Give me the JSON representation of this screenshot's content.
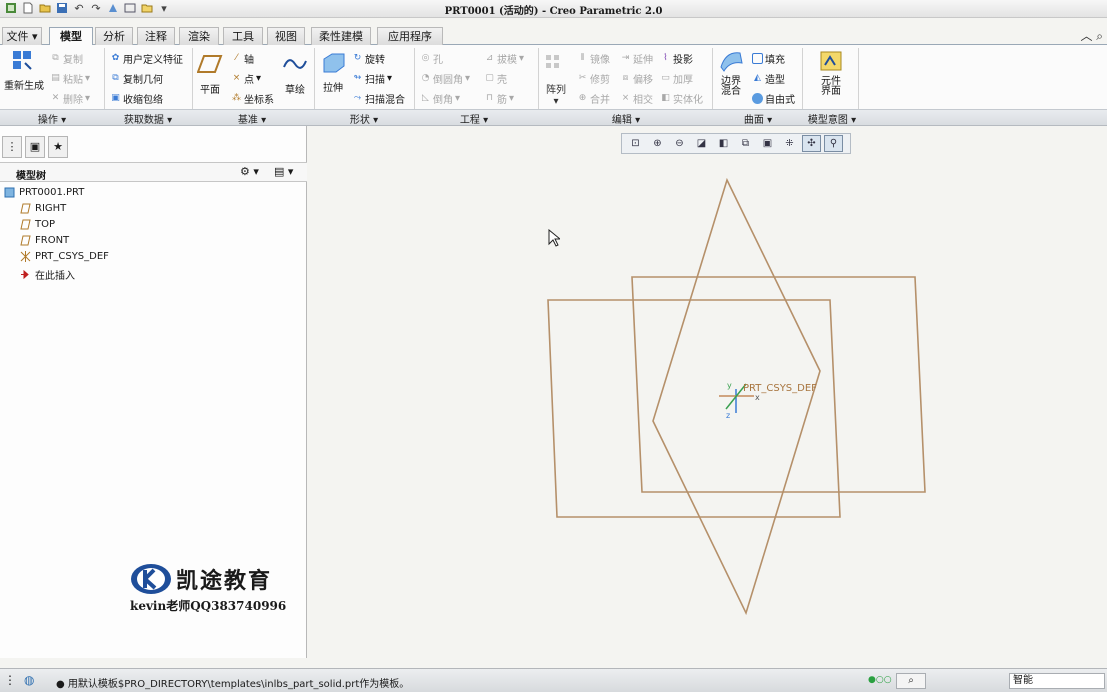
{
  "window": {
    "title": "PRT0001 (活动的) - Creo Parametric 2.0"
  },
  "quick_access": {
    "icons": [
      "app-icon",
      "new-icon",
      "open-icon",
      "save-icon",
      "undo-icon",
      "redo-icon",
      "regenerate-icon",
      "window-icon",
      "close-icon",
      "customize-icon"
    ]
  },
  "tabs": [
    "文件",
    "模型",
    "分析",
    "注释",
    "渲染",
    "工具",
    "视图",
    "柔性建模",
    "应用程序"
  ],
  "ribbon": {
    "operations": {
      "regenerate": "重新生成",
      "copy": "复制",
      "paste": "粘贴",
      "delete": "删除"
    },
    "get_data": {
      "udf": "用户定义特征",
      "copy_geom": "复制几何",
      "shrinkwrap": "收缩包络"
    },
    "datum": {
      "plane": "平面",
      "axis": "轴",
      "point": "点",
      "csys": "坐标系",
      "sketch": "草绘"
    },
    "shapes": {
      "extrude": "拉伸",
      "revolve": "旋转",
      "sweep": "扫描",
      "swept_blend": "扫描混合"
    },
    "engineering": {
      "hole": "孔",
      "round": "倒圆角",
      "chamfer": "倒角",
      "draft": "拔模",
      "shell": "壳",
      "rib": "筋"
    },
    "editing": {
      "pattern": "阵列",
      "mirror": "镜像",
      "trim": "修剪",
      "merge": "合并",
      "extend": "延伸",
      "offset": "偏移",
      "intersect": "相交",
      "project": "投影",
      "thicken": "加厚",
      "solidify": "实体化"
    },
    "surfaces": {
      "boundary_blend": "边界混合",
      "fill": "填充",
      "style": "造型",
      "freestyle": "自由式"
    },
    "model_intent": {
      "component_interface": "元件界面"
    }
  },
  "groups": [
    "操作",
    "获取数据",
    "基准",
    "形状",
    "工程",
    "编辑",
    "曲面",
    "模型意图"
  ],
  "model_tree": {
    "header": "模型树",
    "items": [
      {
        "label": "PRT0001.PRT",
        "icon": "part-icon"
      },
      {
        "label": "RIGHT",
        "icon": "datum-plane-icon"
      },
      {
        "label": "TOP",
        "icon": "datum-plane-icon"
      },
      {
        "label": "FRONT",
        "icon": "datum-plane-icon"
      },
      {
        "label": "PRT_CSYS_DEF",
        "icon": "csys-icon"
      },
      {
        "label": "在此插入",
        "icon": "insert-here-arrow-icon"
      }
    ]
  },
  "watermark": {
    "brand": "凯途教育",
    "contact": "kevin老师QQ383740996"
  },
  "graphics": {
    "csys_label": "PRT_CSYS_DEF",
    "plane_color": "#b5906a"
  },
  "status": {
    "message": "用默认模板$PRO_DIRECTORY\\templates\\inlbs_part_solid.prt作为模板。",
    "filter": "智能"
  },
  "colors": {
    "ribbon_bg": "#fbfbfb",
    "canvas_bg": "#f4f4f1",
    "accent": "#1f4e9a"
  }
}
